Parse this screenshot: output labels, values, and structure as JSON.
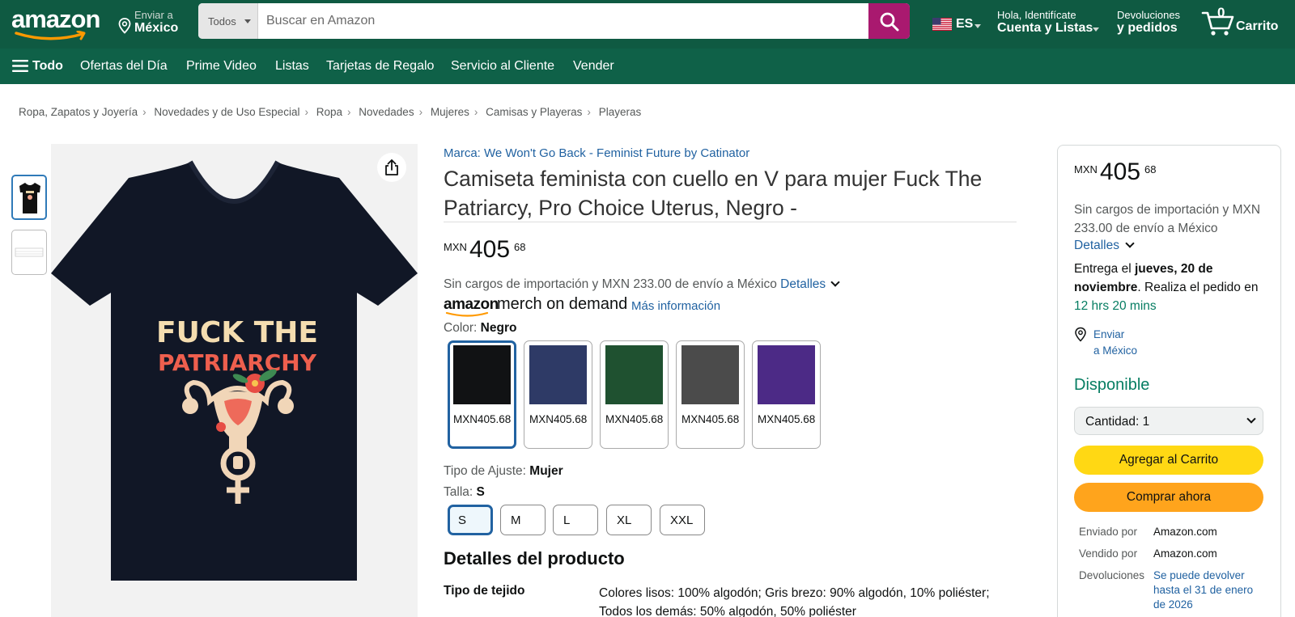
{
  "header": {
    "logo_text": "amazon",
    "deliver_line1": "Enviar a",
    "deliver_line2": "México",
    "search_category": "Todos",
    "search_placeholder": "Buscar en Amazon",
    "language": "ES",
    "account_line1": "Hola, Identifícate",
    "account_line2": "Cuenta y Listas",
    "orders_line1": "Devoluciones",
    "orders_line2": "y pedidos",
    "cart_count": "0",
    "cart_label": "Carrito",
    "brand_color": "#0f5a42",
    "search_button_color": "#a9196f"
  },
  "nav": {
    "all_label": "Todo",
    "items": [
      "Ofertas del Día",
      "Prime Video",
      "Listas",
      "Tarjetas de Regalo",
      "Servicio al Cliente",
      "Vender"
    ]
  },
  "breadcrumb": [
    "Ropa, Zapatos y Joyería",
    "Novedades y de Uso Especial",
    "Ropa",
    "Novedades",
    "Mujeres",
    "Camisas y Playeras",
    "Playeras"
  ],
  "gallery": {
    "shirt_text_line1": "FUCK THE",
    "shirt_text_line2": "PATRIARCHY"
  },
  "product": {
    "brand_link": "Marca: We Won't Go Back - Feminist Future by Catinator",
    "title": "Camiseta feminista con cuello en V para mujer Fuck The Patriarcy, Pro Choice Uterus, Negro -",
    "price_currency": "MXN",
    "price_whole": "405",
    "price_fraction": "68",
    "shipping_text": "Sin cargos de importación y MXN 233.00 de envío a México",
    "details_link": "Detalles",
    "merch_amazon": "amazon",
    "merch_text": "merch on demand",
    "merch_more": "Más información",
    "color_label": "Color:",
    "color_value": "Negro",
    "colors": [
      {
        "name": "Negro",
        "hex": "#111214",
        "price": "MXN405.68"
      },
      {
        "name": "Azul marino",
        "hex": "#2e3a66",
        "price": "MXN405.68"
      },
      {
        "name": "Verde",
        "hex": "#1f5130",
        "price": "MXN405.68"
      },
      {
        "name": "Gris",
        "hex": "#4b4b4b",
        "price": "MXN405.68"
      },
      {
        "name": "Morado",
        "hex": "#4c2a86",
        "price": "MXN405.68"
      }
    ],
    "fit_label": "Tipo de Ajuste:",
    "fit_value": "Mujer",
    "size_label": "Talla:",
    "size_value": "S",
    "sizes": [
      "S",
      "M",
      "L",
      "XL",
      "XXL"
    ],
    "details_heading": "Detalles del producto",
    "spec_key": "Tipo de tejido",
    "spec_value": "Colores lisos: 100% algodón; Gris brezo: 90% algodón, 10% poliéster; Todos los demás: 50% algodón, 50% poliéster"
  },
  "buybox": {
    "price_currency": "MXN",
    "price_whole": "405",
    "price_fraction": "68",
    "shipping_text": "Sin cargos de importación y MXN 233.00 de envío a México",
    "details_link": "Detalles",
    "delivery_prefix": "Entrega el ",
    "delivery_date": "jueves, 20 de noviembre",
    "delivery_mid": ". Realiza el pedido en ",
    "delivery_countdown": "12 hrs 20 mins",
    "location_line1": "Enviar",
    "location_line2": "a México",
    "availability": "Disponible",
    "quantity_label": "Cantidad:",
    "quantity_value": "1",
    "add_to_cart": "Agregar al Carrito",
    "buy_now": "Comprar ahora",
    "shipped_by_label": "Enviado por",
    "shipped_by_value": "Amazon.com",
    "sold_by_label": "Vendido por",
    "sold_by_value": "Amazon.com",
    "returns_label": "Devoluciones",
    "returns_value": "Se puede devolver hasta el 31 de enero de 2026",
    "add_color": "#ffd814",
    "buy_color": "#ffa41c"
  }
}
